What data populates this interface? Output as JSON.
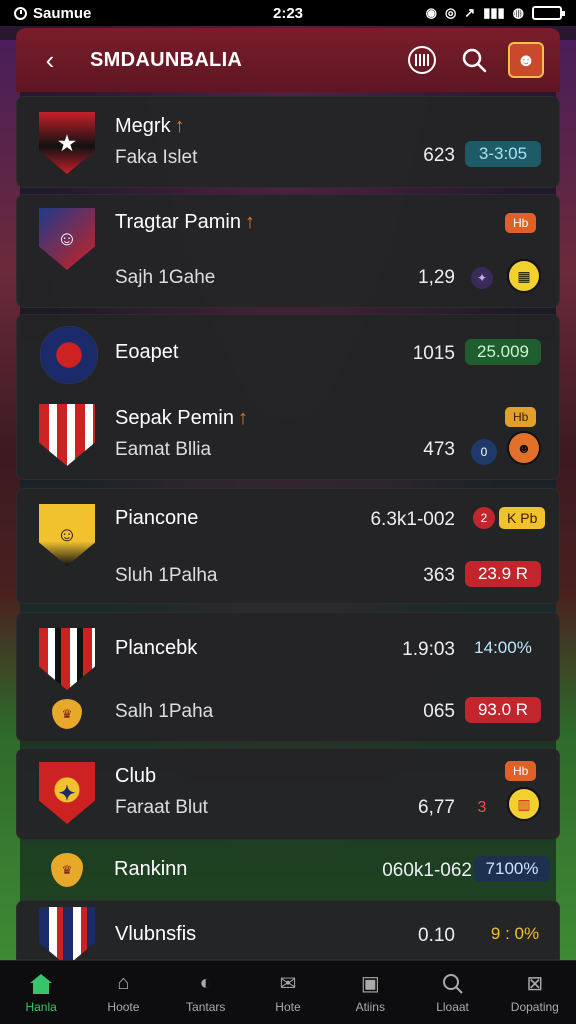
{
  "status_bar": {
    "carrier": "Saumue",
    "time": "2:23"
  },
  "header": {
    "title": "SMDAUNBALIA",
    "back_icon": "back-arrow-icon",
    "stats_icon": "bars-icon",
    "search_icon": "search-icon"
  },
  "rows": [
    {
      "name": "Megrk",
      "sub": "Faka Islet",
      "value": "623",
      "badge": "3-3:05",
      "badge_color": "#1e5b66"
    },
    {
      "name": "Tragtar Pamin",
      "sub": "Sajh 1Gahe",
      "value": "1,29",
      "tag": "Hb"
    },
    {
      "name": "Eoapet",
      "value": "1015",
      "badge": "25.009",
      "badge_color": "#1f5e2e"
    },
    {
      "name": "Sepak Pemin",
      "sub": "Eamat Bllia",
      "value": "473",
      "mini": "0",
      "tag": "Hb"
    },
    {
      "name": "Piancone",
      "value": "6.3k1-002",
      "mini": "2",
      "tag": "K Pb",
      "sub": "Sluh 1Palha",
      "value2": "363",
      "badge": "23.9 R",
      "badge_color": "#c0262c"
    },
    {
      "name": "Plancebk",
      "value": "1.9:03",
      "badge": "14:00%",
      "badge_color": "#1e5b66",
      "sub": "Salh 1Paha",
      "value2": "065",
      "badge2": "93.0 R",
      "badge2_color": "#c0262c"
    },
    {
      "name": "Club",
      "sub": "Faraat Blut",
      "value": "6,77",
      "mini": "3",
      "tag": "Hb"
    },
    {
      "name": "Rankinn",
      "value": "060k1-062",
      "badge": "7100%",
      "badge_color": "#1d3050"
    },
    {
      "name": "Vlubnsfis",
      "value": "0.10",
      "badge": "9 : 0%"
    }
  ],
  "bottom_nav": [
    {
      "label": "Hanla",
      "icon": "home-icon",
      "active": true
    },
    {
      "label": "Hoote",
      "icon": "building-icon",
      "active": false
    },
    {
      "label": "Tantars",
      "icon": "tag-icon",
      "active": false
    },
    {
      "label": "Hote",
      "icon": "mail-icon",
      "active": false
    },
    {
      "label": "Atiins",
      "icon": "chat-icon",
      "active": false
    },
    {
      "label": "Lloaat",
      "icon": "search-icon",
      "active": false
    },
    {
      "label": "Dopating",
      "icon": "inbox-icon",
      "active": false
    }
  ]
}
